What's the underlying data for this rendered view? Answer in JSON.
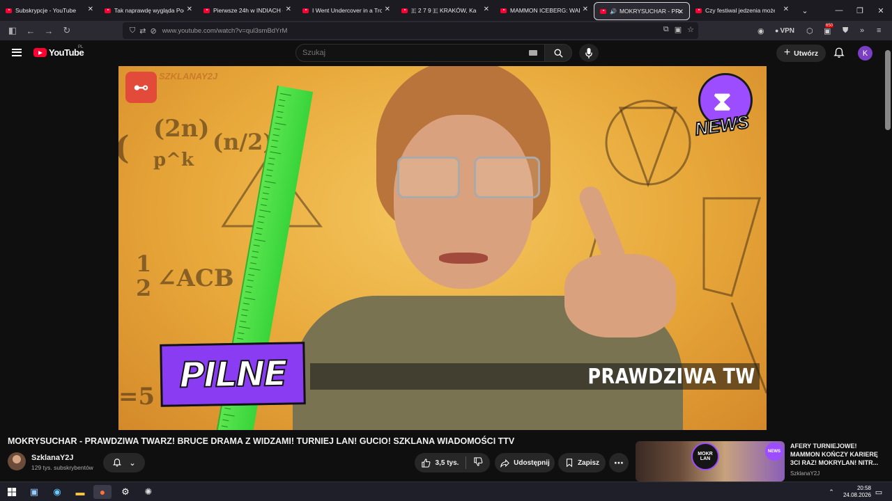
{
  "browser": {
    "tabs": [
      {
        "title": "Subskrypcje - YouTube",
        "active": false
      },
      {
        "title": "Tak naprawdę wygląda Pociąg",
        "active": false
      },
      {
        "title": "Pierwsze 24h w INDIACH - Yo",
        "active": false
      },
      {
        "title": "I Went Undercover in a Troub",
        "active": false
      },
      {
        "title": "🇪 2 7 9 🇪 KRAKÓW, Ka",
        "active": false
      },
      {
        "title": "MAMMON ICEBERG: WARSTW",
        "active": false
      },
      {
        "title": "MOKRYSUCHAR - PRAWD",
        "active": true
      },
      {
        "title": "Czy festiwal jedzenia może by",
        "active": false
      }
    ],
    "url": "www.youtube.com/watch?v=qul3smBdYrM",
    "vpn_label": "VPN",
    "ext_badge": "650"
  },
  "youtube": {
    "logo_text": "YouTube",
    "region": "PL",
    "search_placeholder": "Szukaj",
    "create_label": "Utwórz",
    "avatar_letter": "K"
  },
  "video": {
    "overlay_channel": "SZKLANAY2J",
    "news_logo": "NEWS",
    "pilne": "PILNE",
    "ticker": "PRAWDZIWA TW",
    "math": [
      "(2n)",
      "p^k",
      "(n/2)",
      "1",
      "2",
      "∠ACB",
      "=5",
      "("
    ]
  },
  "meta": {
    "title": "MOKRYSUCHAR - PRAWDZIWA TWARZ! BRUCE DRAMA Z WIDZAMI! TURNIEJ LAN! GUCIO! SZKLANA WIADOMOŚCI TTV",
    "channel_name": "SzklanaY2J",
    "subscribers": "129 tys. subskrybentów",
    "likes": "3,5 tys.",
    "share_label": "Udostępnij",
    "save_label": "Zapisz"
  },
  "sidebar_video": {
    "title": "AFERY TURNIEJOWE! MAMMON KOŃCZY KARIERĘ 3CI RAZ! MOKRYLAN! NITR...",
    "channel": "SzklanaY2J",
    "thumb_text_1": "MOKR LAN",
    "thumb_text_2": "NEWS"
  },
  "taskbar": {
    "time": "20:58",
    "date": "24.08.2026"
  }
}
